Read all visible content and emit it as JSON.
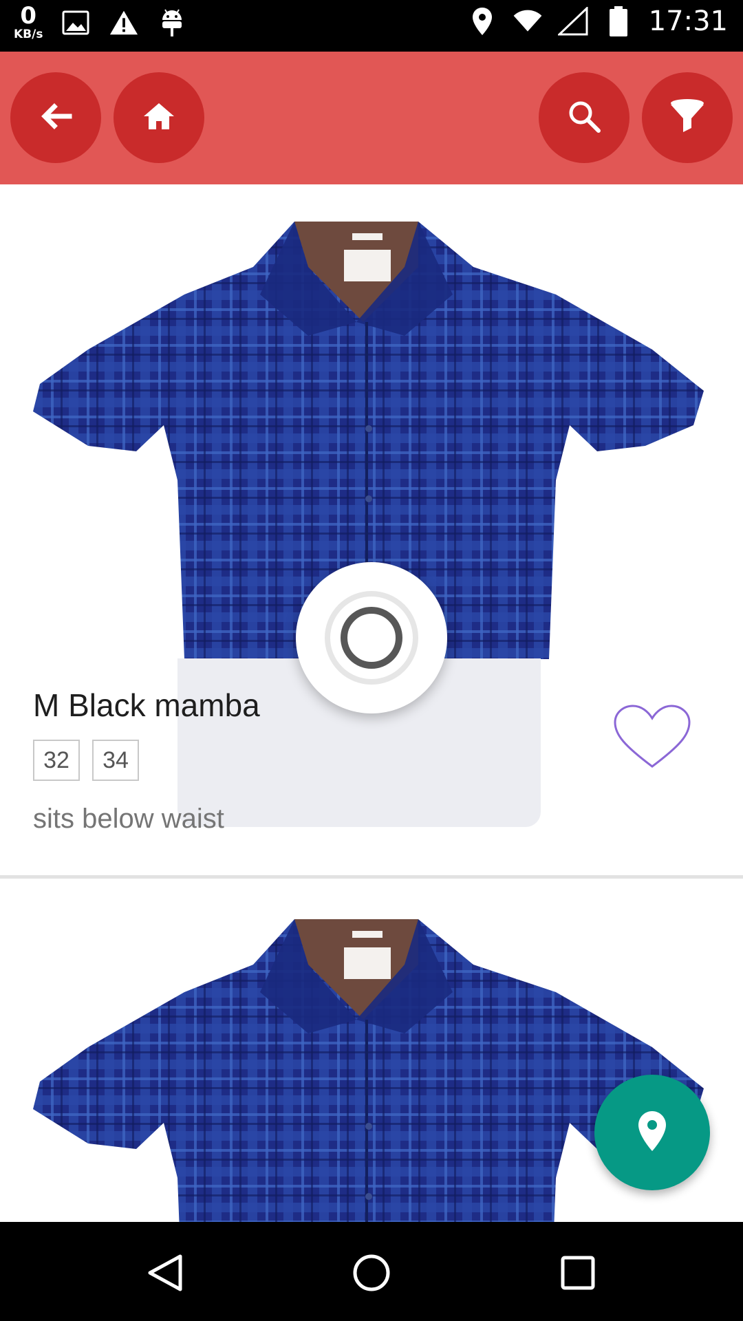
{
  "status_bar": {
    "net_speed_value": "0",
    "net_speed_unit": "KB/s",
    "time": "17:31",
    "icons": [
      "image-icon",
      "warning-icon",
      "android-icon",
      "location-icon",
      "wifi-icon",
      "signal-icon",
      "battery-icon"
    ]
  },
  "app_bar": {
    "color": "#e15755",
    "button_color": "#c92b2b",
    "buttons": [
      "back-icon",
      "home-icon",
      "search-icon",
      "filter-icon"
    ]
  },
  "products": [
    {
      "title": "M Black mamba",
      "sizes": [
        "32",
        "34"
      ],
      "description": "sits below waist",
      "favorite_icon": "heart-outline-icon"
    },
    {
      "image": "blue-plaid-shirt"
    }
  ],
  "fab": {
    "icon": "location-icon",
    "color": "#069985"
  },
  "nav_bar": {
    "buttons": [
      "back-triangle-icon",
      "home-circle-icon",
      "recents-square-icon"
    ]
  }
}
